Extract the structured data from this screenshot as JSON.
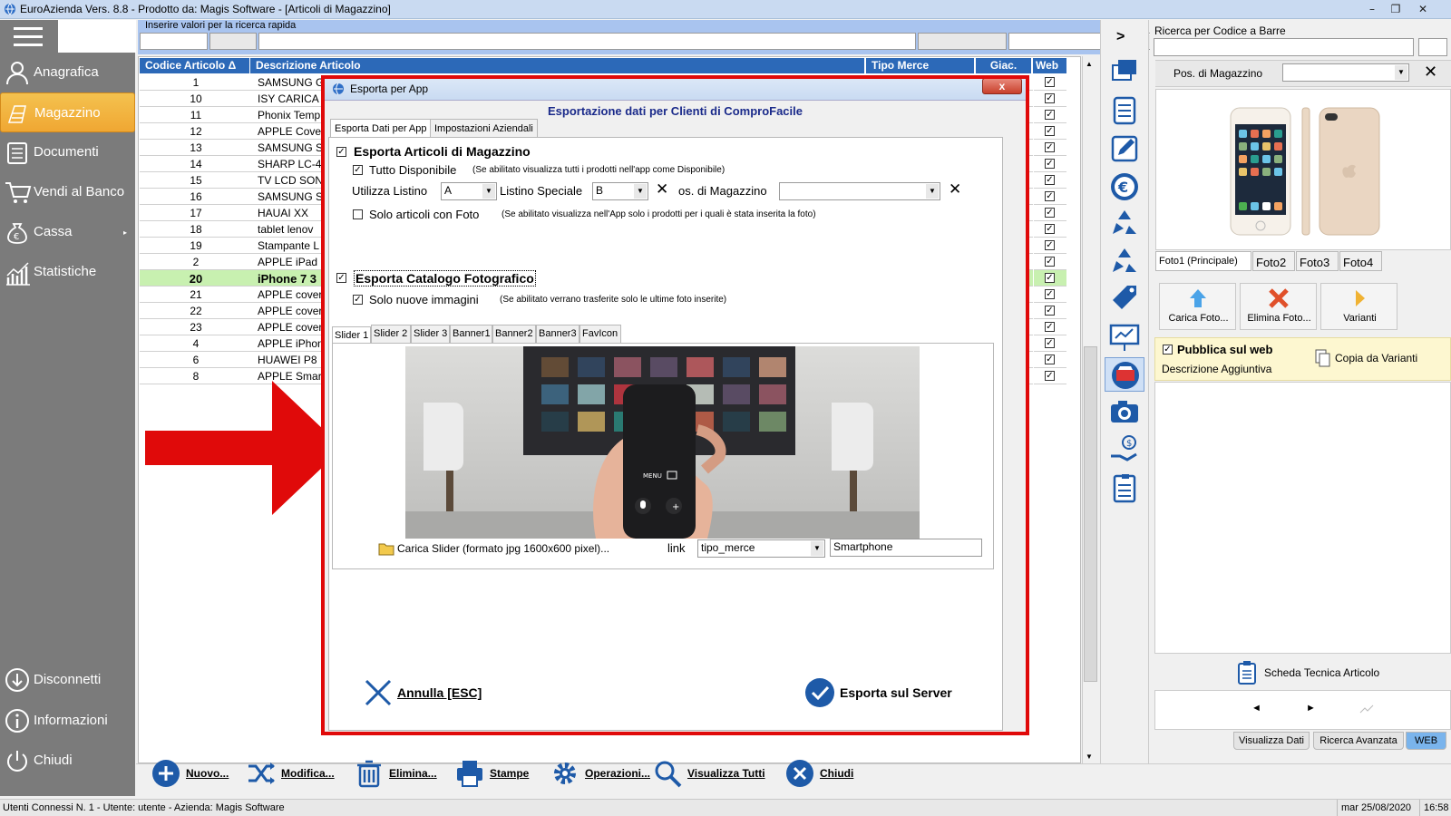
{
  "window": {
    "title": "EuroAzienda Vers. 8.8 - Prodotto da: Magis Software - [Articoli di Magazzino]"
  },
  "sidebar": {
    "items": [
      {
        "label": "Anagrafica"
      },
      {
        "label": "Magazzino"
      },
      {
        "label": "Documenti"
      },
      {
        "label": "Vendi al Banco"
      },
      {
        "label": "Cassa"
      },
      {
        "label": "Statistiche"
      }
    ],
    "bottom_items": [
      {
        "label": "Disconnetti"
      },
      {
        "label": "Informazioni"
      },
      {
        "label": "Chiudi"
      }
    ]
  },
  "search": {
    "hint": "Inserire valori per la ricerca rapida"
  },
  "grid": {
    "columns": [
      "Codice Articolo",
      "Descrizione Articolo",
      "Tipo Merce",
      "Giac.",
      "Web"
    ],
    "sort_indicator": "Δ",
    "rows": [
      {
        "code": "1",
        "desc": "SAMSUNG G"
      },
      {
        "code": "10",
        "desc": "ISY CARICA"
      },
      {
        "code": "11",
        "desc": "Phonix Temp"
      },
      {
        "code": "12",
        "desc": "APPLE Cove"
      },
      {
        "code": "13",
        "desc": "SAMSUNG S"
      },
      {
        "code": "14",
        "desc": "SHARP LC-4"
      },
      {
        "code": "15",
        "desc": "TV LCD SON"
      },
      {
        "code": "16",
        "desc": "SAMSUNG S"
      },
      {
        "code": "17",
        "desc": "HAUAI XX"
      },
      {
        "code": "18",
        "desc": "tablet lenov"
      },
      {
        "code": "19",
        "desc": "Stampante L"
      },
      {
        "code": "2",
        "desc": "APPLE iPad"
      },
      {
        "code": "20",
        "desc": "iPhone 7 3",
        "highlight": true
      },
      {
        "code": "21",
        "desc": "APPLE cover"
      },
      {
        "code": "22",
        "desc": "APPLE cover"
      },
      {
        "code": "23",
        "desc": "APPLE cover"
      },
      {
        "code": "4",
        "desc": "APPLE iPhon"
      },
      {
        "code": "6",
        "desc": "HUAWEI P8"
      },
      {
        "code": "8",
        "desc": "APPLE Smar"
      }
    ]
  },
  "dialog": {
    "title": "Esporta per App",
    "close_label": "x",
    "header": "Esportazione dati per Clienti di ComproFacile",
    "tabs": [
      "Esporta Dati per App",
      "Impostazioni Aziendali"
    ],
    "export_articles": {
      "label": "Esporta Articoli di Magazzino",
      "all_available_label": "Tutto Disponibile",
      "all_available_note": "(Se abilitato visualizza tutti i prodotti nell'app come Disponibile)",
      "listino_label": "Utilizza Listino",
      "listino_value": "A",
      "listino_speciale_label": "Listino Speciale",
      "listino_speciale_value": "B",
      "pos_label": "os. di Magazzino",
      "photo_only_label": "Solo articoli con Foto",
      "photo_only_note": "(Se abilitato visualizza nell'App solo i prodotti per i quali è stata inserita la foto)"
    },
    "export_catalog": {
      "label": "Esporta Catalogo Fotografico",
      "new_images_label": "Solo nuove immagini",
      "new_images_note": "(Se abilitato verrano trasferite solo le ultime foto inserite)"
    },
    "slider_tabs": [
      "Slider 1",
      "Slider 2",
      "Slider 3",
      "Banner1",
      "Banner2",
      "Banner3",
      "FavIcon"
    ],
    "remote_labels": [
      "MENU"
    ],
    "upload_label": "Carica Slider (formato jpg 1600x600 pixel)...",
    "link_label": "link",
    "link_type_value": "tipo_merce",
    "link_value": "Smartphone",
    "cancel_label": "Annulla [ESC]",
    "export_label": "Esporta sul Server"
  },
  "right_panel": {
    "barcode_label": "Ricerca per Codice a Barre",
    "position_label": "Pos. di Magazzino",
    "nav_label": ">",
    "photo_tabs": [
      "Foto1 (Principale)",
      "Foto2",
      "Foto3",
      "Foto4"
    ],
    "photo_buttons": [
      "Carica Foto...",
      "Elimina Foto...",
      "Varianti"
    ],
    "publish_label": "Pubblica sul web",
    "additional_desc_label": "Descrizione Aggiuntiva",
    "copy_variants_label": "Copia da Varianti",
    "tech_sheet_label": "Scheda Tecnica Articolo",
    "nav_prev": "◄",
    "nav_next": "►",
    "bottom_tabs": [
      "Visualizza Dati",
      "Ricerca Avanzata",
      "WEB"
    ]
  },
  "bottom_toolbar": {
    "buttons": [
      "Nuovo...",
      "Modifica...",
      "Elimina...",
      "Stampe",
      "Operazioni...",
      "Visualizza Tutti",
      "Chiudi"
    ]
  },
  "status_bar": {
    "left": "Utenti Connessi N. 1 - Utente: utente - Azienda: Magis Software",
    "date": "mar 25/08/2020",
    "time": "16:58"
  },
  "colors": {
    "grid_header": "#2c69b8",
    "sidebar": "#7b7b7b",
    "active_nav": "#f0a733",
    "highlight_row": "#c8f0b0",
    "dialog_header": "#1a2a8a",
    "annotation_red": "#e00a0a"
  }
}
